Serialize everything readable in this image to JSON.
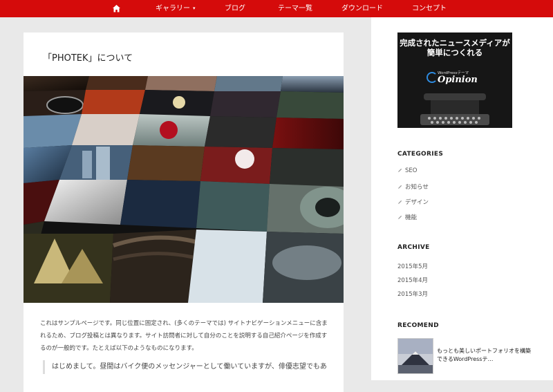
{
  "nav": {
    "home_icon": "home-icon",
    "items": [
      {
        "label": "ギャラリー",
        "has_dropdown": true
      },
      {
        "label": "ブログ"
      },
      {
        "label": "テーマ一覧"
      },
      {
        "label": "ダウンロード"
      },
      {
        "label": "コンセプト"
      }
    ],
    "dropdown_icon": "▾",
    "bg_color": "#d50b0b"
  },
  "page": {
    "title": "「PHOTEK」について",
    "body": "これはサンプルページです。同じ位置に固定され、(多くのテーマでは) サイトナビゲーションメニューに含まれるため、ブログ投稿とは異なります。サイト訪問者に対して自分のことを説明する自己紹介ページを作成するのが一般的です。たとえば以下のようなものになります。",
    "quote": "はじめまして。昼間はバイク便のメッセンジャーとして働いていますが、俳優志望でもあ"
  },
  "sidebar": {
    "ad": {
      "headline_line1": "完成されたニュースメディアが",
      "headline_line2": "簡単につくれる",
      "small": "WordPressテーマ",
      "brand": "Opinion"
    },
    "categories_title": "CATEGORIES",
    "categories": [
      "SEO",
      "お知らせ",
      "デザイン",
      "機能"
    ],
    "archive_title": "ARCHIVE",
    "archives": [
      "2015年5月",
      "2015年4月",
      "2015年3月"
    ],
    "recomend_title": "RECOMEND",
    "recomend_item": "もっとも美しいポートフォリオを構築できるWordPressテ…"
  }
}
